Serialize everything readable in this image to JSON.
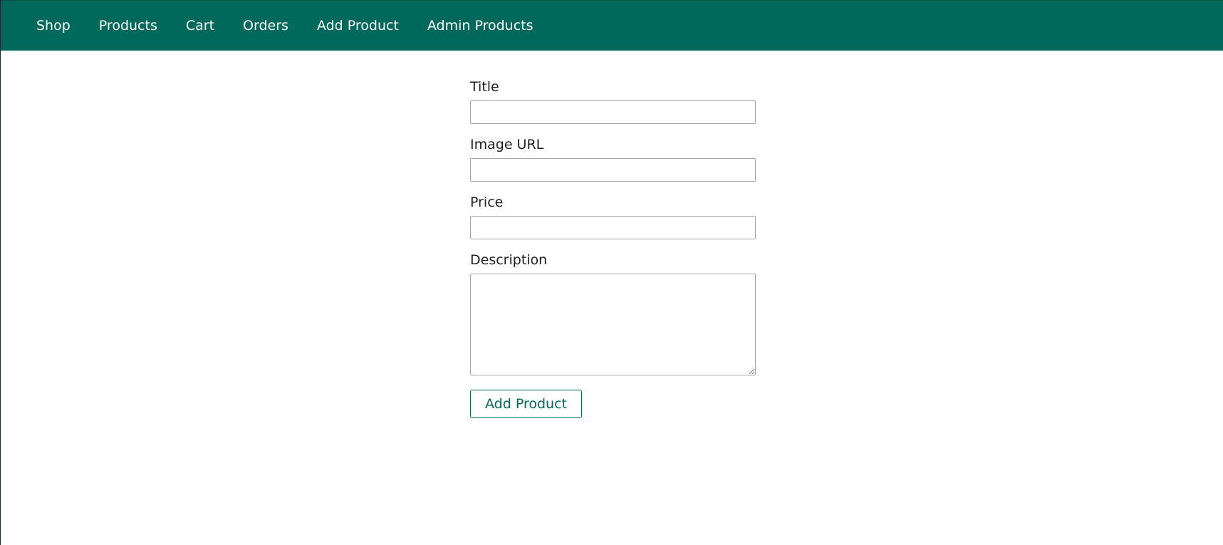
{
  "nav": {
    "items": [
      {
        "label": "Shop"
      },
      {
        "label": "Products"
      },
      {
        "label": "Cart"
      },
      {
        "label": "Orders"
      },
      {
        "label": "Add Product"
      },
      {
        "label": "Admin Products"
      }
    ],
    "background_color": "#00695c"
  },
  "form": {
    "title": {
      "label": "Title",
      "value": "",
      "placeholder": ""
    },
    "image_url": {
      "label": "Image URL",
      "value": "",
      "placeholder": ""
    },
    "price": {
      "label": "Price",
      "value": "",
      "placeholder": ""
    },
    "description": {
      "label": "Description",
      "value": "",
      "placeholder": ""
    },
    "submit_label": "Add Product",
    "accent_color": "#00695c"
  }
}
